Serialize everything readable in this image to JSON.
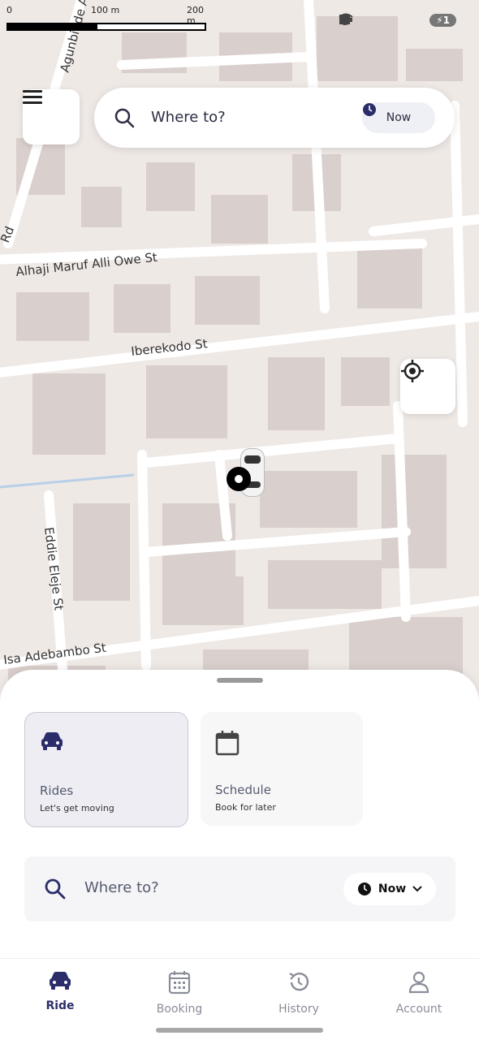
{
  "map": {
    "scale_labels": [
      "0",
      "100 m",
      "200 m"
    ],
    "streets": [
      "Agunbiade Ajibo",
      "Rd",
      "Alhaji Maruf Alli Owe St",
      "Iberekodo St",
      "Eddie Eleje St",
      "Isa Adebambo St"
    ]
  },
  "status": {
    "battery": "1"
  },
  "top_search": {
    "label": "Where to?",
    "now": "Now"
  },
  "sheet": {
    "cards": [
      {
        "title": "Rides",
        "subtitle": "Let's get moving"
      },
      {
        "title": "Schedule",
        "subtitle": "Book for later"
      }
    ],
    "search": {
      "label": "Where to?",
      "now": "Now"
    }
  },
  "nav": {
    "items": [
      {
        "label": "Ride"
      },
      {
        "label": "Booking"
      },
      {
        "label": "History"
      },
      {
        "label": "Account"
      }
    ]
  },
  "colors": {
    "accent": "#2b2d6b",
    "map_bg": "#efe9e6",
    "road": "#ffffff"
  }
}
